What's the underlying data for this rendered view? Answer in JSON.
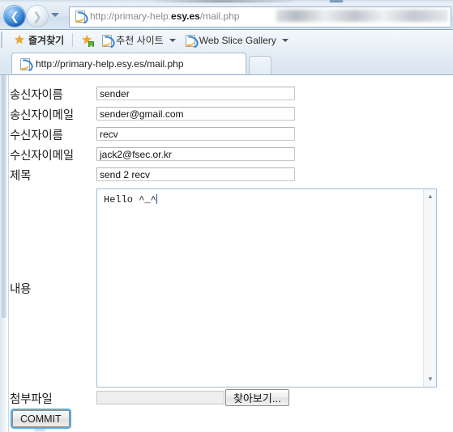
{
  "browser": {
    "nav": {
      "back_tooltip": "뒤로",
      "forward_tooltip": "앞으로",
      "recent_pages_tooltip": "최근 페이지",
      "address_prefix": "http://primary-help.",
      "address_domain": "esy.es",
      "address_suffix": "/mail.php",
      "address_full": "http://primary-help.esy.es/mail.php"
    },
    "favorites": {
      "favorites_label": "즐겨찾기",
      "add_favorites_label": "",
      "suggested_sites_label": "추천 사이트",
      "web_slice_label": "Web Slice Gallery"
    },
    "tabs": [
      {
        "title": "http://primary-help.esy.es/mail.php"
      }
    ],
    "new_tab_label": ""
  },
  "page": {
    "fields": [
      {
        "label": "송신자이름",
        "value": "sender",
        "name": "sender-name"
      },
      {
        "label": "송신자이메일",
        "value": "sender@gmail.com",
        "name": "sender-email"
      },
      {
        "label": "수신자이름",
        "value": "recv",
        "name": "recipient-name"
      },
      {
        "label": "수신자이메일",
        "value": "jack2@fsec.or.kr",
        "name": "recipient-email"
      },
      {
        "label": "제목",
        "value": "send 2 recv",
        "name": "subject"
      }
    ],
    "body": {
      "label": "내용",
      "value": "Hello ^_^"
    },
    "attachment": {
      "label": "첨부파일",
      "value": "",
      "browse_label": "찾아보기..."
    },
    "submit_label": "COMMIT"
  },
  "colors": {
    "focus_ring": "#59aee0",
    "textarea_border": "#9bbedd",
    "star": "#f5a623",
    "ie_blue": "#2f86d8"
  }
}
